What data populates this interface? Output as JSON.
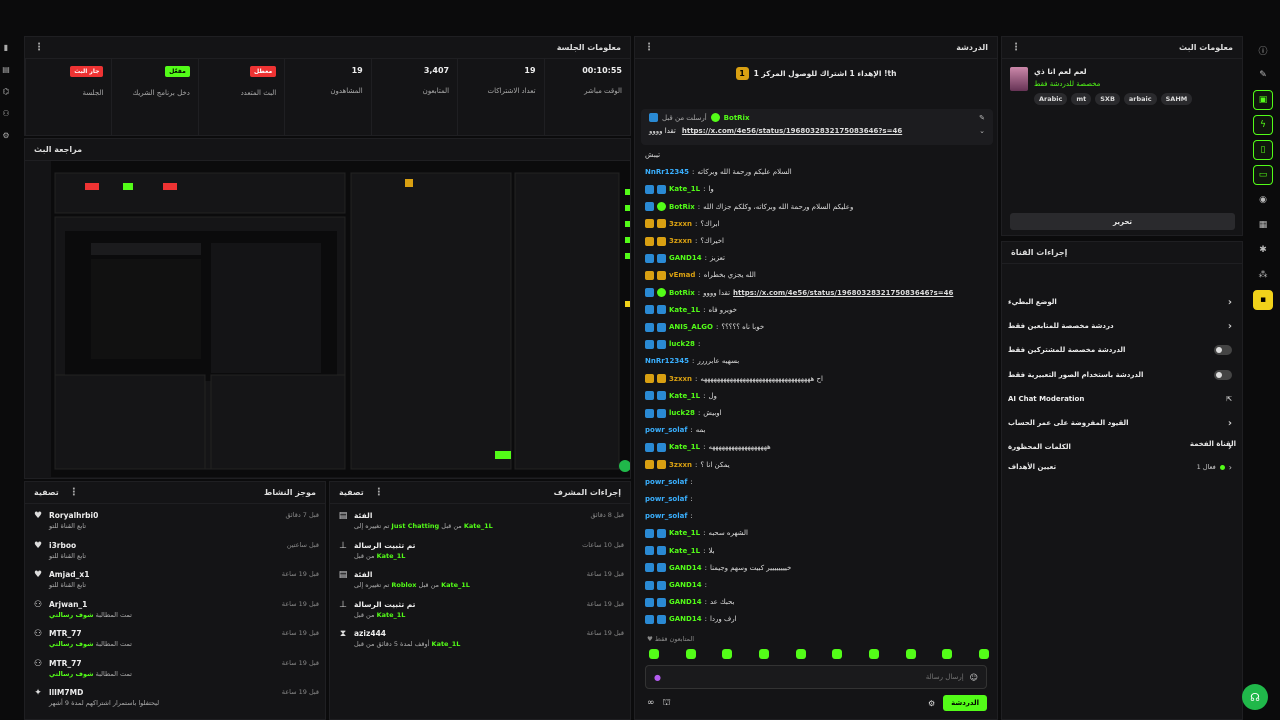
{
  "session": {
    "title": "معلومات الجلسة",
    "stats": [
      {
        "label": "الوقت مباشر",
        "value": "00:10:55"
      },
      {
        "label": "تعداد الاشتراكات",
        "value": "19"
      },
      {
        "label": "المتابعون",
        "value": "3,407"
      },
      {
        "label": "المشاهدون",
        "value": "19"
      },
      {
        "label": "البث المتعدد",
        "value": "معطل",
        "tag": "red"
      },
      {
        "label": "دخل برنامج الشريك",
        "value": "مفعّل",
        "tag": "green"
      },
      {
        "label": "الجلسة",
        "value": "جار البث",
        "tag": "red"
      }
    ]
  },
  "preview": {
    "title": "مراجعة البث"
  },
  "activity": {
    "title": "موجز النشاط",
    "filter": "تصفية",
    "items": [
      {
        "name": "Roryalhrbi0",
        "sub": "تابع القناة للتو",
        "time": "قبل 7 دقائق",
        "icon": "heart-icon"
      },
      {
        "name": "i3rboo",
        "sub": "تابع القناة للتو",
        "time": "قبل ساعتين",
        "icon": "heart-icon"
      },
      {
        "name": "Amjad_x1",
        "sub": "تابع القناة للتو",
        "time": "قبل 19 ساعة",
        "icon": "heart-icon"
      },
      {
        "name": "Arjwan_1",
        "sub": "تمت المطالبة ",
        "sub_hl": "شوف رسالتي",
        "time": "قبل 19 ساعة",
        "icon": "person-icon"
      },
      {
        "name": "MTR_77",
        "sub": "تمت المطالبة ",
        "sub_hl": "شوف رسالتي",
        "time": "قبل 19 ساعة",
        "icon": "person-icon"
      },
      {
        "name": "MTR_77",
        "sub": "تمت المطالبة ",
        "sub_hl": "شوف رسالتي",
        "time": "قبل 19 ساعة",
        "icon": "person-icon"
      },
      {
        "name": "llIM7MD",
        "sub": "ليحتفلوا باستمرار اشتراكهم لمدة 9 أشهر",
        "time": "قبل 19 ساعة",
        "icon": "star-icon"
      }
    ]
  },
  "modactions": {
    "title": "إجراءات المشرف",
    "filter": "تصفية",
    "items": [
      {
        "title": "الفئة",
        "line": "تم تغييره إلى ",
        "hl": "Just Chatting",
        "mid": " من قبل ",
        "user": "Kate_1L",
        "time": "قبل 8 دقائق",
        "icon": "tag-icon"
      },
      {
        "title": "تم تثبيت الرسالة",
        "line": "من قبل ",
        "user": "Kate_1L",
        "time": "قبل 10 ساعات",
        "icon": "pin-icon"
      },
      {
        "title": "الفئة",
        "line": "تم تغييره إلى ",
        "hl": "Roblox",
        "mid": " من قبل ",
        "user": "Kate_1L",
        "time": "قبل 19 ساعة",
        "icon": "tag-icon"
      },
      {
        "title": "تم تثبيت الرسالة",
        "line": "من قبل ",
        "user": "Kate_1L",
        "time": "قبل 19 ساعة",
        "icon": "pin-icon"
      },
      {
        "title": "aziz444",
        "line": "أوقف لمدة 5 دقائق من قبل ",
        "user": "Kate_1L",
        "time": "قبل 19 ساعة",
        "icon": "hourglass-icon"
      }
    ]
  },
  "chat": {
    "title": "الدردشة",
    "top_banner": "الإهداء 1 اشتراك للوصول المركز 1 !th",
    "pinned_user": "BotRix",
    "pinned_label": "أرسلت من قبل",
    "pinned_text": "تقدا وووو",
    "pinned_link": "https://x.com/4e56/status/1968032832175083646?s=46",
    "messages": [
      {
        "user": "",
        "text": "تيبش",
        "kind": "plain"
      },
      {
        "user": "NnRr12345",
        "text": "السلام عليكم ورحمة الله وبركاته",
        "kind": "p"
      },
      {
        "user": "Kate_1L",
        "text": "وا",
        "kind": "b"
      },
      {
        "user": "BotRix",
        "text": "وعليكم السلام ورحمة الله وبركاته، وكلكم جزاك الله",
        "kind": "g"
      },
      {
        "user": "3zxxn",
        "text": "ابراك؟",
        "kind": "y"
      },
      {
        "user": "3zxxn",
        "text": "اخيراك؟",
        "kind": "y"
      },
      {
        "user": "GAND14",
        "text": "تعزيز",
        "kind": "b"
      },
      {
        "user": "vEmad",
        "text": "الله يجزي بخطراه",
        "kind": "y"
      },
      {
        "user": "BotRix",
        "text": "تقدا وووو",
        "link": "https://x.com/4e56/status/1968032832175083646?s=46",
        "kind": "g"
      },
      {
        "user": "Kate_1L",
        "text": "خويرو فاه",
        "kind": "b"
      },
      {
        "user": "ANIS_ALGO",
        "text": "خوبا ناه ؟؟؟؟؟",
        "kind": "b"
      },
      {
        "user": "luck28",
        "text": "",
        "kind": "b"
      },
      {
        "user": "NnRr12345",
        "text": "بسهيه عابرررر",
        "kind": "p"
      },
      {
        "user": "3zxxn",
        "text": "اح ههههههههههههههههههههههههههههههههههه",
        "kind": "y"
      },
      {
        "user": "Kate_1L",
        "text": "ول",
        "kind": "b"
      },
      {
        "user": "luck28",
        "text": "اوبيش",
        "kind": "b"
      },
      {
        "user": "powr_solaf",
        "text": "بمه",
        "kind": "p"
      },
      {
        "user": "Kate_1L",
        "text": "ههههههههههههههههههه",
        "kind": "b"
      },
      {
        "user": "3zxxn",
        "text": "يمكن انا ؟",
        "kind": "y"
      },
      {
        "user": "powr_solaf",
        "text": "",
        "kind": "p"
      },
      {
        "user": "powr_solaf",
        "text": "",
        "kind": "p"
      },
      {
        "user": "powr_solaf",
        "text": "",
        "kind": "p"
      },
      {
        "user": "Kate_1L",
        "text": "الشهره سحبه",
        "kind": "b"
      },
      {
        "user": "Kate_1L",
        "text": "بلا",
        "kind": "b"
      },
      {
        "user": "GAND14",
        "text": "خيييييييير كبيت وسهم وجيمنا",
        "kind": "b"
      },
      {
        "user": "GAND14",
        "text": "",
        "kind": "b"
      },
      {
        "user": "GAND14",
        "text": "بحبك عد",
        "kind": "b"
      },
      {
        "user": "GAND14",
        "text": "ارف وردا",
        "kind": "b"
      }
    ],
    "followers_only": "المتابعون فقط",
    "input_placeholder": "إرسال رسالة",
    "send_label": "الدردشة"
  },
  "streaminfo": {
    "title": "معلومات البث",
    "stream_title": "لعم لعم انا ذي",
    "category": "مخصصة للدردشة فقط",
    "tags": [
      "Arabic",
      "mt",
      "SXB",
      "arbaic",
      "SAHM"
    ],
    "edit_label": "تحرير"
  },
  "channel": {
    "title": "إجراءات القناة",
    "rows": [
      {
        "label": "الوضع البطيء",
        "ctrl": "chevron"
      },
      {
        "label": "دردشة مخصصة للمتابعين فقط",
        "ctrl": "chevron"
      },
      {
        "label": "الدردشة مخصصة للمشتركين فقط",
        "ctrl": "toggle"
      },
      {
        "label": "الدردشة باستخدام الصور التعبيرية فقط",
        "ctrl": "toggle"
      },
      {
        "label": "AI Chat Moderation",
        "ctrl": "ext"
      },
      {
        "label": "القيود المفروضة على عمر الحساب",
        "ctrl": "chevron"
      },
      {
        "label": "الكلمات المحظورة",
        "ctrl": "chevron"
      }
    ],
    "promo_title": "القناة الفخمة",
    "goals_label": "تعيين الأهداف",
    "goals_status": "فعال 1"
  },
  "colors": {
    "accent": "#53fc18",
    "red": "#e33333",
    "bg": "#141416"
  }
}
